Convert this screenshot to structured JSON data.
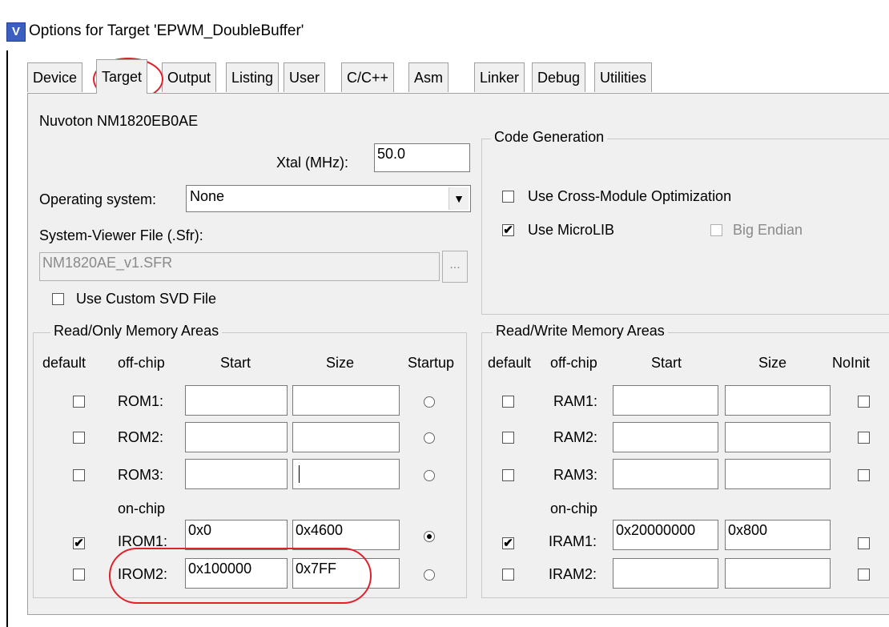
{
  "window": {
    "title": "Options for Target 'EPWM_DoubleBuffer'",
    "icon": "app-icon"
  },
  "tabs": [
    {
      "label": "Device"
    },
    {
      "label": "Target",
      "active": true
    },
    {
      "label": "Output"
    },
    {
      "label": "Listing"
    },
    {
      "label": "User"
    },
    {
      "label": "C/C++"
    },
    {
      "label": "Asm"
    },
    {
      "label": "Linker"
    },
    {
      "label": "Debug"
    },
    {
      "label": "Utilities"
    }
  ],
  "device": {
    "name": "Nuvoton NM1820EB0AE"
  },
  "xtal": {
    "label": "Xtal (MHz):",
    "value": "50.0"
  },
  "os": {
    "label": "Operating system:",
    "value": "None"
  },
  "svd": {
    "label": "System-Viewer File (.Sfr):",
    "value": "NM1820AE_v1.SFR",
    "browse": "...",
    "custom_label": "Use Custom SVD File"
  },
  "codegen": {
    "title": "Code Generation",
    "cross_module": "Use Cross-Module Optimization",
    "microlib": "Use MicroLIB",
    "big_endian": "Big Endian"
  },
  "rom": {
    "title": "Read/Only Memory Areas",
    "headers": {
      "default": "default",
      "offchip": "off-chip",
      "start": "Start",
      "size": "Size",
      "startup": "Startup"
    },
    "onchip_label": "on-chip",
    "rows": [
      {
        "label": "ROM1:",
        "start": "",
        "size": "",
        "default": false,
        "startup": false
      },
      {
        "label": "ROM2:",
        "start": "",
        "size": "",
        "default": false,
        "startup": false
      },
      {
        "label": "ROM3:",
        "start": "",
        "size": "",
        "default": false,
        "startup": false
      },
      {
        "label": "IROM1:",
        "start": "0x0",
        "size": "0x4600",
        "default": true,
        "startup": true
      },
      {
        "label": "IROM2:",
        "start": "0x100000",
        "size": "0x7FF",
        "default": false,
        "startup": false
      }
    ]
  },
  "ram": {
    "title": "Read/Write Memory Areas",
    "headers": {
      "default": "default",
      "offchip": "off-chip",
      "start": "Start",
      "size": "Size",
      "noinit": "NoInit"
    },
    "onchip_label": "on-chip",
    "rows": [
      {
        "label": "RAM1:",
        "start": "",
        "size": "",
        "default": false
      },
      {
        "label": "RAM2:",
        "start": "",
        "size": "",
        "default": false
      },
      {
        "label": "RAM3:",
        "start": "",
        "size": "",
        "default": false
      },
      {
        "label": "IRAM1:",
        "start": "0x20000000",
        "size": "0x800",
        "default": true
      },
      {
        "label": "IRAM2:",
        "start": "",
        "size": "",
        "default": false
      }
    ]
  },
  "checks": {
    "on": "✔",
    "off": ""
  }
}
